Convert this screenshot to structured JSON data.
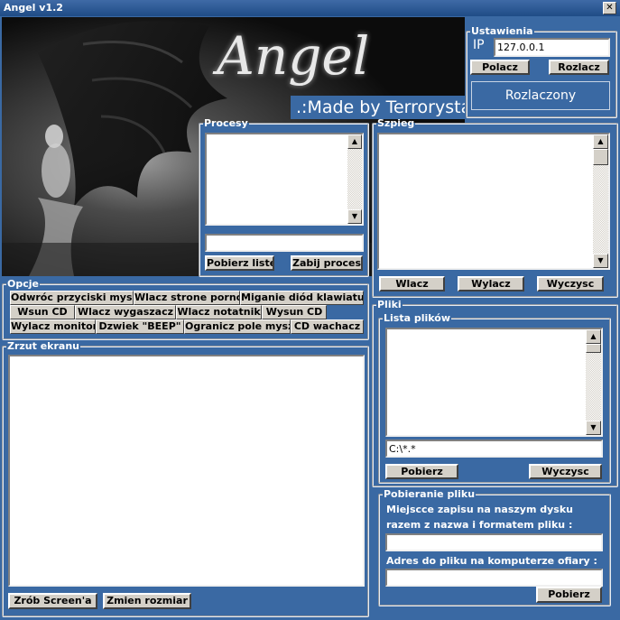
{
  "window": {
    "title": "Angel v1.2",
    "close": "✕"
  },
  "banner": {
    "logo_text": "Angel",
    "made_by": ".:Made by Terrorysta"
  },
  "settings": {
    "legend": "Ustawienia",
    "ip_label": "IP",
    "ip_value": "127.0.0.1",
    "connect": "Polacz",
    "disconnect": "Rozlacz",
    "status": "Rozlaczony"
  },
  "processes": {
    "legend": "Procesy",
    "get_list": "Pobierz liste",
    "kill": "Zabij proces",
    "input_value": ""
  },
  "spy": {
    "legend": "Szpieg",
    "on": "Wlacz",
    "off": "Wylacz",
    "clear": "Wyczysc"
  },
  "options": {
    "legend": "Opcje",
    "rows": [
      [
        "Odwróc przyciski myszy",
        "Wlacz strone porno",
        "Miganie diód klawiatury"
      ],
      [
        "Wsun CD",
        "Wlacz wygaszacz",
        "Wlacz notatnik",
        "Wysun CD"
      ],
      [
        "Wylacz monitor",
        "Dzwiek \"BEEP\"",
        "Ogranicz pole myszy",
        "CD wachacz"
      ]
    ]
  },
  "screenshot": {
    "legend": "Zrzut ekranu",
    "take": "Zrób Screen'a",
    "resize": "Zmien rozmiar"
  },
  "files": {
    "legend": "Pliki",
    "list_legend": "Lista plików",
    "path_value": "C:\\*.*",
    "get": "Pobierz",
    "clear": "Wyczysc"
  },
  "download": {
    "legend": "Pobieranie pliku",
    "save_label_1": "Miejscce zapisu na naszym dysku",
    "save_label_2": "razem z nazwa i formatem pliku :",
    "remote_label": "Adres do pliku na komputerze ofiary :",
    "get": "Pobierz"
  },
  "icons": {
    "up": "▲",
    "down": "▼"
  },
  "colors": {
    "background": "#3a69a3",
    "button": "#d4d0c8"
  }
}
